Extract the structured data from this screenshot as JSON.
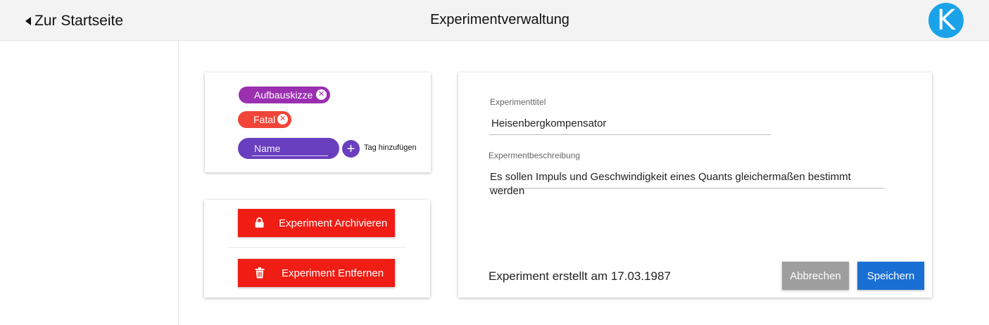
{
  "header": {
    "back_label": "Zur Startseite",
    "title": "Experimentverwaltung",
    "logo_letter": "K"
  },
  "tags": {
    "items": [
      {
        "label": "Aufbauskizze",
        "color": "#9a2fb0",
        "close_icon": "x-circle-icon"
      },
      {
        "label": "Fatal",
        "color": "#f04538",
        "close_icon": "x-circle-icon"
      }
    ],
    "new_tag": {
      "placeholder": "Name",
      "color": "#6a3fbf"
    },
    "add_label": "Tag hinzufügen",
    "add_icon": "plus-circle-icon"
  },
  "actions": {
    "archive_label": "Experiment Archivieren",
    "archive_icon": "lock-icon",
    "remove_label": "Experiment Entfernen",
    "remove_icon": "trash-icon",
    "color": "#ef1d14"
  },
  "form": {
    "title_label": "Experimenttitel",
    "title_value": "Heisenbergkompensator",
    "description_label": "Expermentbeschreibung",
    "description_value": "Es sollen Impuls und Geschwindigkeit eines Quants gleichermaßen bestimmt werden",
    "created_text": "Experiment erstellt am 17.03.1987",
    "cancel_label": "Abbrechen",
    "save_label": "Speichern",
    "save_color": "#1a6fd4",
    "cancel_color": "#9e9e9e"
  }
}
